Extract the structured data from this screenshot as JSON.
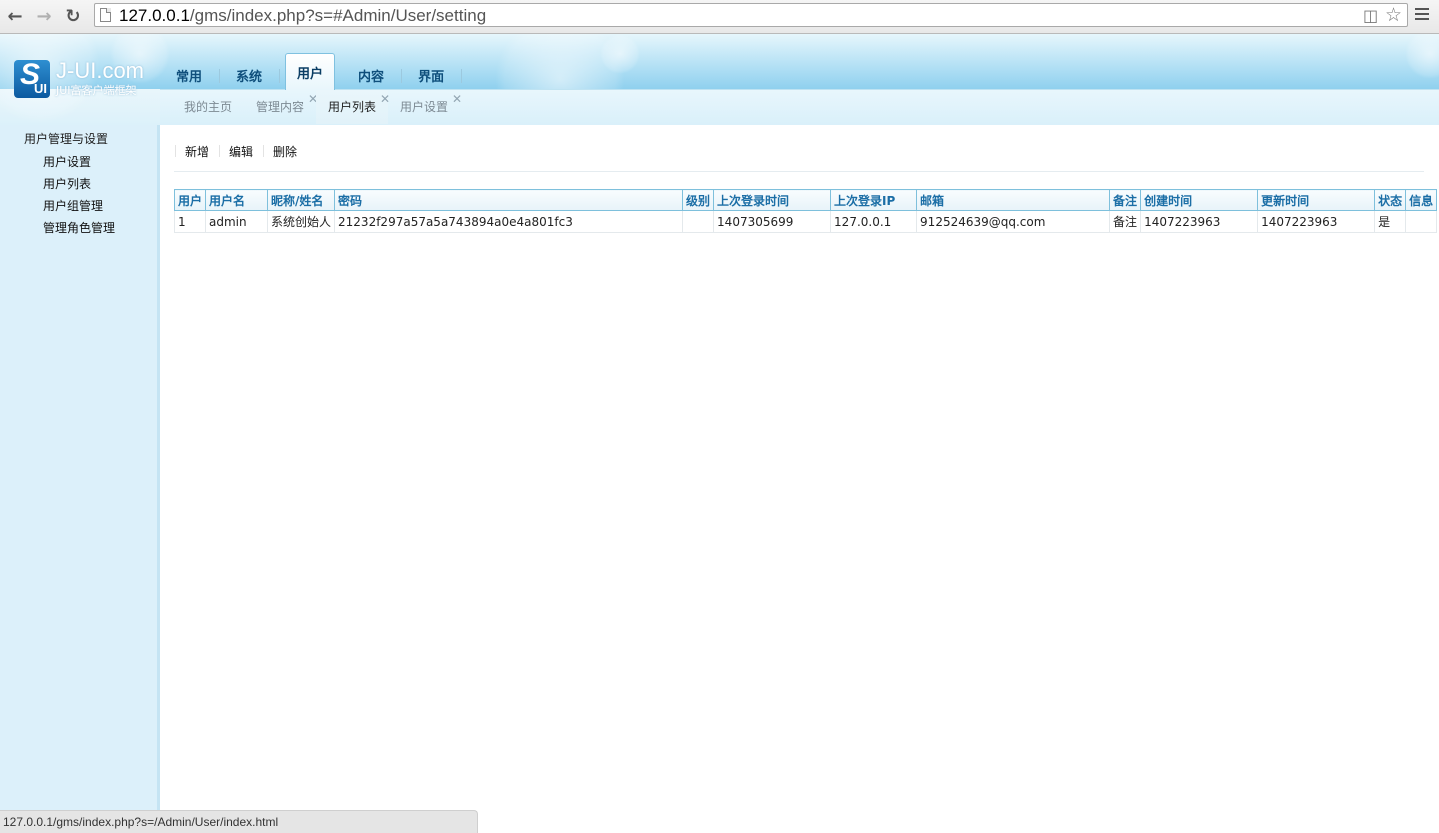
{
  "browser": {
    "url_host": "127.0.0.1",
    "url_path": "/gms/index.php?s=#Admin/User/setting",
    "status_url": "127.0.0.1/gms/index.php?s=/Admin/User/index.html"
  },
  "logo": {
    "mark_letter": "S",
    "mark_ui": "UI",
    "title": "J-UI.com",
    "subtitle": "JUI富客户端框架"
  },
  "main_tabs": [
    {
      "label": "常用"
    },
    {
      "label": "系统"
    },
    {
      "label": "用户",
      "active": true
    },
    {
      "label": "内容"
    },
    {
      "label": "界面"
    }
  ],
  "sub_tabs": [
    {
      "label": "我的主页"
    },
    {
      "label": "管理内容"
    },
    {
      "label": "用户列表",
      "active": true
    },
    {
      "label": "用户设置"
    }
  ],
  "sidebar": {
    "title": "用户管理与设置",
    "items": [
      {
        "label": "用户设置"
      },
      {
        "label": "用户列表"
      },
      {
        "label": "用户组管理"
      },
      {
        "label": "管理角色管理"
      }
    ]
  },
  "toolbar": {
    "add": "新增",
    "edit": "编辑",
    "delete": "删除"
  },
  "table": {
    "headers": [
      "用户",
      "用户名",
      "昵称/姓名",
      "密码",
      "级别",
      "上次登录时间",
      "上次登录IP",
      "邮箱",
      "备注",
      "创建时间",
      "更新时间",
      "状态",
      "信息"
    ],
    "rows": [
      [
        "1",
        "admin",
        "系统创始人",
        "21232f297a57a5a743894a0e4a801fc3",
        "",
        "1407305699",
        "127.0.0.1",
        "912524639@qq.com",
        "备注",
        "1407223963",
        "1407223963",
        "是",
        ""
      ]
    ]
  },
  "colors": {
    "header_blue": "#1b6ea6",
    "sidebar_bg": "#dcf0fa",
    "grid_border": "#7ec0dc"
  }
}
